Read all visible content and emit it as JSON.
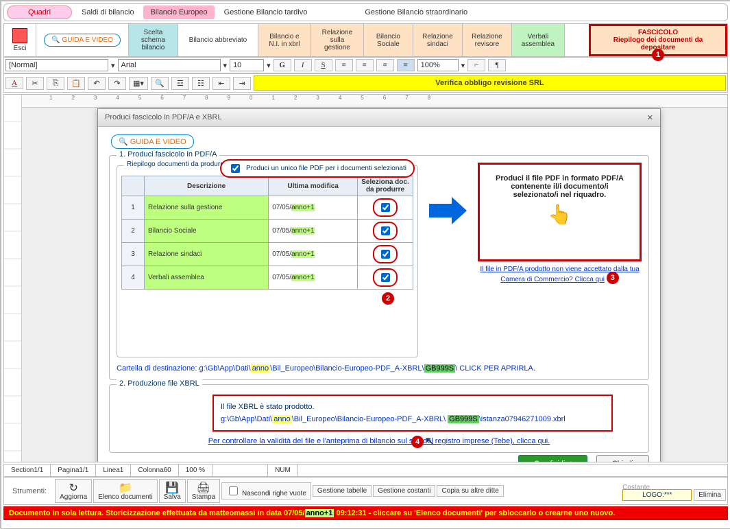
{
  "topTabs": {
    "quadri": "Quadri",
    "saldi": "Saldi di bilancio",
    "europeo": "Bilancio Europeo",
    "tardivo": "Gestione Bilancio tardivo",
    "straord": "Gestione Bilancio straordinario"
  },
  "ribbon": {
    "esci": "Esci",
    "guida": "GUIDA E VIDEO",
    "scelta": "Scelta schema bilancio",
    "abbrev": "Bilancio abbreviato",
    "ni": "Bilancio e N.I. in xbrl",
    "relGest": "Relazione sulla gestione",
    "bilSoc": "Bilancio Sociale",
    "relSind": "Relazione sindaci",
    "relRev": "Relazione revisore",
    "verbali": "Verbali assemblea",
    "fascTitle": "FASCICOLO",
    "fascSub": "Riepilogo dei documenti da depositare"
  },
  "fmt": {
    "style": "[Normal]",
    "font": "Arial",
    "size": "10",
    "zoom": "100%",
    "verify": "Verifica obbligo revisione SRL"
  },
  "modal": {
    "title": "Produci fascicolo in PDF/A e XBRL",
    "guida": "GUIDA E VIDEO",
    "s1": "1. Produci fascicolo in PDF/A",
    "riepilogo": "Riepilogo documenti da produrre",
    "chk": "Produci un unico file PDF per i documenti selezionati",
    "cols": {
      "desc": "Descrizione",
      "mod": "Ultima modifica",
      "sel": "Seleziona doc. da produrre"
    },
    "rows": [
      {
        "n": "1",
        "d": "Relazione sulla gestione",
        "m": "07/05/",
        "a": "anno+1"
      },
      {
        "n": "2",
        "d": "Bilancio Sociale",
        "m": "07/05/",
        "a": "anno+1"
      },
      {
        "n": "3",
        "d": "Relazione sindaci",
        "m": "07/05/",
        "a": "anno+1"
      },
      {
        "n": "4",
        "d": "Verbali assemblea",
        "m": "07/05/",
        "a": "anno+1"
      }
    ],
    "pdfBox": "Produci il file PDF in formato PDF/A contenente il/i documento/i selezionato/i nel riquadro.",
    "camera": "Il file in PDF/A prodotto non viene accettato dalla tua Camera di Commercio? Clicca qui",
    "cartella": {
      "pre": "Cartella di destinazione: ",
      "p1": "g:\\Gb\\App\\Dati\\",
      "anno": "anno",
      "p2": "\\Bil_Europeo\\Bilancio-Europeo-PDF_A-XBRL\\",
      "code": "GB999S",
      "p3": "\\ CLICK PER APRIRLA."
    },
    "s2": "2. Produzione file XBRL",
    "xbrlOk": "Il file XBRL è stato prodotto.",
    "xbrlPath": {
      "p1": "g:\\Gb\\App\\Dati\\",
      "anno": "anno",
      "p2": "\\Bil_Europeo\\Bilancio-Europeo-PDF_A-XBRL\\ ",
      "code": "GB999S",
      "p3": "\\istanza07946271009.xbrl"
    },
    "validate": "Per controllare la validità del file e l'anteprima di bilancio sul sito del registro imprese (Tebe), clicca qui.",
    "condividi": "Condividi",
    "chiudi": "Chiudi"
  },
  "status": {
    "section": "Section1/1",
    "pagina": "Pagina1/1",
    "linea": "Linea1",
    "col": "Colonna60",
    "zoom": "100 %",
    "num": "NUM"
  },
  "tools": {
    "strumenti": "Strumenti:",
    "aggiorna": "Aggiorna",
    "elenco": "Elenco documenti",
    "salva": "Salva",
    "stampa": "Stampa",
    "nascondi": "Nascondi righe vuote",
    "gesTab": "Gestione tabelle",
    "gesCost": "Gestione costanti",
    "copia": "Copia su altre ditte",
    "costante": "Costante",
    "logo": "LOGO:***",
    "elimina": "Elimina"
  },
  "redbar": {
    "t1": "Documento in sola lettura. Storicizzazione effettuata da matteomassi in data 07/05/",
    "anno": "anno+1",
    "t2": " 09:12:31 - cliccare su 'Elenco documenti' per sbloccarlo o crearne uno nuovo."
  },
  "badges": {
    "b1": "1",
    "b2": "2",
    "b3": "3",
    "b4": "4"
  }
}
